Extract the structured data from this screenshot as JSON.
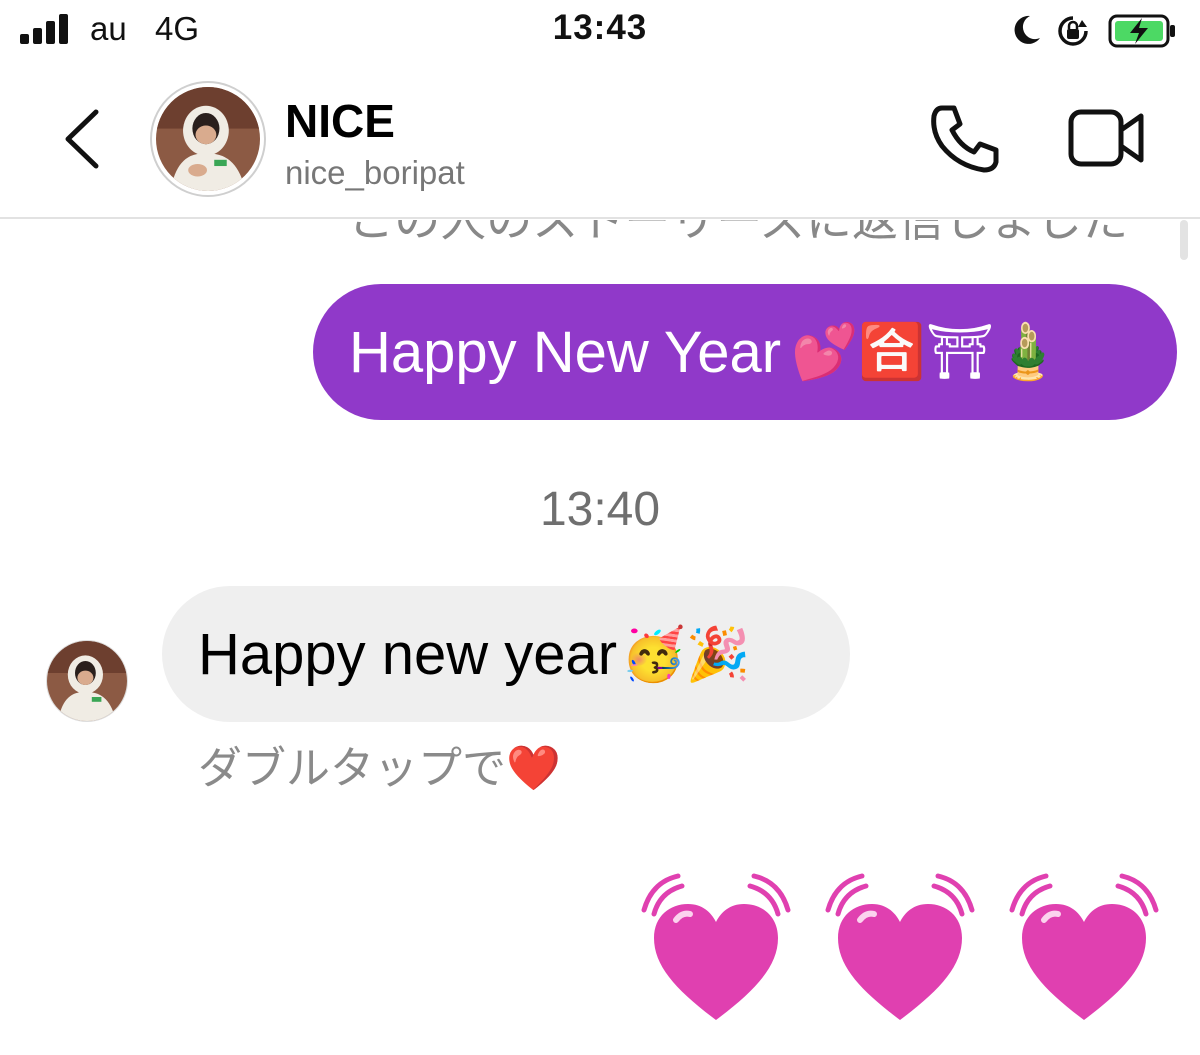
{
  "status_bar": {
    "carrier": "au",
    "network": "4G",
    "time": "13:43",
    "icons": [
      "signal-bars-icon",
      "moon-icon",
      "orientation-lock-icon",
      "battery-charging-icon"
    ]
  },
  "header": {
    "display_name": "NICE",
    "username": "nice_boripat",
    "icons": [
      "back-chevron-icon",
      "phone-icon",
      "video-camera-icon"
    ]
  },
  "conversation": {
    "story_reply_note": "この人のストーリーズに返信しました",
    "sent_message": {
      "text": "Happy New Year",
      "emoji": "💕🈴⛩🎍"
    },
    "timestamp": "13:40",
    "received_message": {
      "text": "Happy new year",
      "emoji": "🥳🎉"
    },
    "double_tap_hint": "ダブルタップで❤️",
    "reaction_hearts": [
      "💓",
      "💓",
      "💓"
    ]
  },
  "colors": {
    "sent_bubble": "#9039c9",
    "received_bubble": "#efefef",
    "heart_pink": "#e040b0",
    "battery_green": "#4cd964"
  }
}
